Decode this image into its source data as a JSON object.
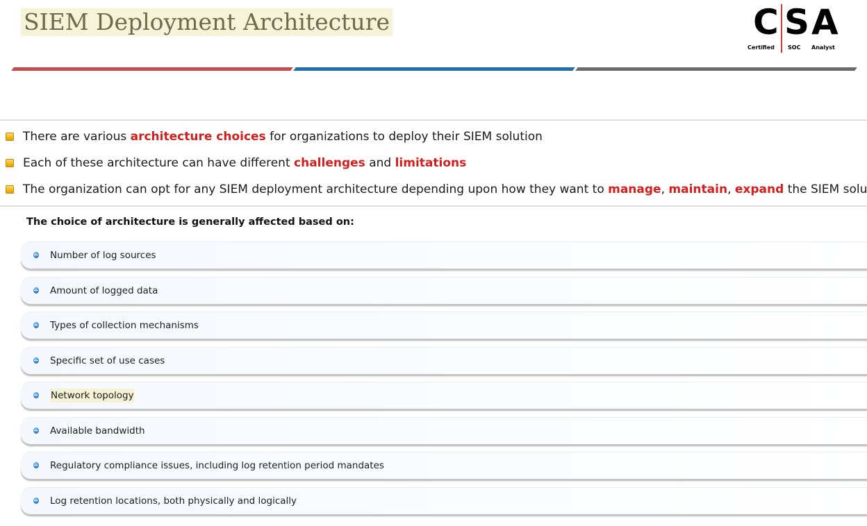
{
  "slide": {
    "title": "SIEM Deployment Architecture"
  },
  "logo": {
    "letters": [
      "C",
      "S",
      "A"
    ],
    "words": [
      "Certified",
      "SOC",
      "Analyst"
    ]
  },
  "bullets": [
    {
      "parts": [
        {
          "text": "There are various ",
          "hl": false
        },
        {
          "text": "architecture choices",
          "hl": true
        },
        {
          "text": " for organizations to deploy their SIEM solution",
          "hl": false
        }
      ]
    },
    {
      "parts": [
        {
          "text": "Each of these architecture can have different ",
          "hl": false
        },
        {
          "text": "challenges",
          "hl": true
        },
        {
          "text": " and ",
          "hl": false
        },
        {
          "text": "limitations",
          "hl": true
        }
      ]
    },
    {
      "parts": [
        {
          "text": "The organization can opt for any SIEM deployment architecture depending upon how they want to ",
          "hl": false
        },
        {
          "text": "manage",
          "hl": true
        },
        {
          "text": ", ",
          "hl": false
        },
        {
          "text": "maintain",
          "hl": true
        },
        {
          "text": ", ",
          "hl": false
        },
        {
          "text": "expand",
          "hl": true
        },
        {
          "text": " the SIEM solution",
          "hl": false
        }
      ]
    }
  ],
  "factors_heading": "The choice of architecture is generally affected based on:",
  "factors": [
    {
      "text": "Number of log sources",
      "highlighted": false
    },
    {
      "text": "Amount of logged data",
      "highlighted": false
    },
    {
      "text": "Types of collection mechanisms",
      "highlighted": false
    },
    {
      "text": "Specific set of use cases",
      "highlighted": false
    },
    {
      "text": "Network topology",
      "highlighted": true
    },
    {
      "text": "Available bandwidth",
      "highlighted": false
    },
    {
      "text": "Regulatory compliance issues, including log retention period mandates",
      "highlighted": false
    },
    {
      "text": "Log retention locations, both physically and logically",
      "highlighted": false
    }
  ],
  "colors": {
    "highlight_red": "#d41e1e",
    "stripe_red": "#c9484a",
    "stripe_blue": "#1f6fae",
    "stripe_gray": "#6b6b6b",
    "bullet_gold": "#f1b418",
    "dot_blue": "#2a7fd0"
  },
  "icons": {
    "bullet": "gold-square-bullet-icon",
    "factor": "blue-dot-icon"
  }
}
